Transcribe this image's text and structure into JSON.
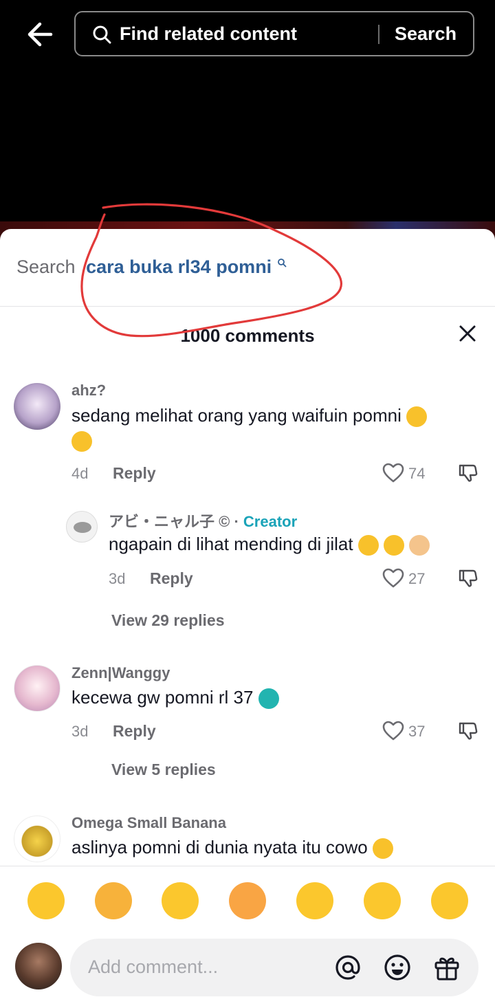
{
  "top": {
    "search_placeholder": "Find related content",
    "search_button": "Search"
  },
  "related_search": {
    "label": "Search",
    "query": "cara buka rl34 pomni"
  },
  "comments_header": {
    "count_label": "1000 comments"
  },
  "comments": [
    {
      "username": "ahz?",
      "text": "sedang melihat orang yang waifuin pomni",
      "age": "4d",
      "reply_label": "Reply",
      "likes": "74"
    },
    {
      "username": "アビ・ニャル子 ©︎",
      "creator_label": "Creator",
      "dot": "·",
      "text": "ngapain di lihat mending di jilat",
      "age": "3d",
      "reply_label": "Reply",
      "likes": "27"
    },
    {
      "view_replies": "View 29 replies"
    },
    {
      "username": "Zenn|Wanggy",
      "text": "kecewa gw pomni rl 37",
      "age": "3d",
      "reply_label": "Reply",
      "likes": "37",
      "view_replies": "View 5 replies"
    },
    {
      "username": "Omega Small Banana",
      "text": "aslinya pomni di dunia nyata itu cowo"
    }
  ],
  "composer": {
    "placeholder": "Add comment..."
  },
  "colors": {
    "annotation_red": "#e23a3a",
    "creator": "#1aa3b8",
    "query": "#2f5f96"
  }
}
